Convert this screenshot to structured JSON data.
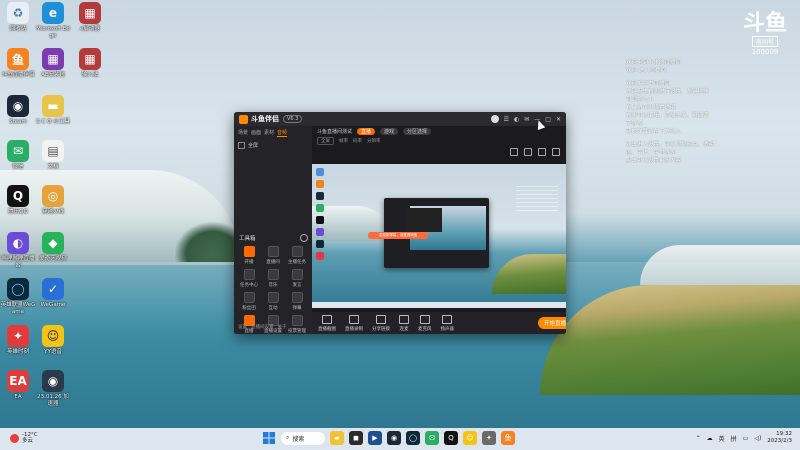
{
  "desktop": {
    "icons": [
      {
        "label": "回收站",
        "color": "#e8eef5",
        "glyph": "♻",
        "fg": "#4a78b0"
      },
      {
        "label": "Microsoft Edge",
        "color": "#1f8fd8",
        "glyph": "e",
        "fg": "#fff"
      },
      {
        "label": "e启动器",
        "color": "#b33b3b",
        "glyph": "▦",
        "fg": "#fff"
      },
      {
        "label": "斗鱼直播伴侣",
        "color": "#f5821f",
        "glyph": "鱼",
        "fg": "#fff"
      },
      {
        "label": "AE安装包",
        "color": "#7a3cae",
        "glyph": "▦",
        "fg": "#fff"
      },
      {
        "label": "输入法",
        "color": "#b33b3b",
        "glyph": "▦",
        "fg": "#fff"
      },
      {
        "label": "Steam",
        "color": "#1b2838",
        "glyph": "◉",
        "fg": "#fff"
      },
      {
        "label": "S C O 小工具",
        "color": "#e8c44a",
        "glyph": "▬",
        "fg": "#fff"
      },
      {
        "label": "微信",
        "color": "#2aae67",
        "glyph": "✉",
        "fg": "#fff"
      },
      {
        "label": "文档",
        "color": "#f2f2f2",
        "glyph": "▤",
        "fg": "#555"
      },
      {
        "label": "腾讯QQ",
        "color": "#111",
        "glyph": "Q",
        "fg": "#fff"
      },
      {
        "label": "穿越火线",
        "color": "#e6a23c",
        "glyph": "◎",
        "fg": "#fff"
      },
      {
        "label": "哔哩哔哩直播姬",
        "color": "#6a4cd6",
        "glyph": "◐",
        "fg": "#fff"
      },
      {
        "label": "爱奇艺视频",
        "color": "#27b35a",
        "glyph": "◆",
        "fg": "#fff"
      },
      {
        "label": "英雄联盟WeGame",
        "color": "#0d2a3a",
        "glyph": "◯",
        "fg": "#58c7ff"
      },
      {
        "label": "WeGame",
        "color": "#2a6fd8",
        "glyph": "✓",
        "fg": "#fff"
      },
      {
        "label": "英雄时刻",
        "color": "#e23b3b",
        "glyph": "✦",
        "fg": "#fff"
      },
      {
        "label": "YY语音",
        "color": "#f5c218",
        "glyph": "☺",
        "fg": "#222"
      },
      {
        "label": "EA",
        "color": "#e23b3b",
        "glyph": "EA",
        "fg": "#fff"
      },
      {
        "label": "23.01.26 加速器",
        "color": "#2b3a4a",
        "glyph": "◉",
        "fg": "#fff"
      }
    ]
  },
  "stream_logo": {
    "mark": "斗鱼",
    "badge": "房间号",
    "room": "100009"
  },
  "chat_overlay": {
    "lines": [
      "欢迎来到小米的直播间",
      "欢迎 进入直播间",
      "",
      "欢迎关注本直播间",
      "左键点击右侧进行设置，左键拉伸",
      "可调整大小",
      "右上角可以设置透明",
      "右侧可以编辑，添加头像，粗细调",
      "节等等",
      "新的弹幕请在下方输入",
      "",
      "双击进入设置，可以调整颜色、透明",
      "度、字体、字号等等",
      "点击可以设置更多内容"
    ]
  },
  "app": {
    "title": "斗鱼伴侣",
    "version": "V6.3",
    "left_tabs": [
      "场景",
      "画面",
      "素材",
      "音频"
    ],
    "scene_label": "全屏",
    "tools_title": "工具箱",
    "tools": [
      {
        "label": "开播",
        "hot": true
      },
      {
        "label": "直播间",
        "hot": false
      },
      {
        "label": "主播任务",
        "hot": false
      },
      {
        "label": "任务中心",
        "hot": false
      },
      {
        "label": "音乐",
        "hot": false
      },
      {
        "label": "发言",
        "hot": false
      },
      {
        "label": "粉丝团",
        "hot": false
      },
      {
        "label": "互动",
        "hot": false
      },
      {
        "label": "弹幕",
        "hot": false
      },
      {
        "label": "直播",
        "hot": true
      },
      {
        "label": "直播设置",
        "hot": false
      },
      {
        "label": "投票管理",
        "hot": false
      }
    ],
    "lp_bottom": [
      "设置",
      "直播间设置",
      "关于"
    ],
    "top_bar": {
      "room_title": "斗鱼直播间测试",
      "live_tag": "直播",
      "tag2": "游戏",
      "tag3": "分区选择"
    },
    "sub_bar": [
      "全屏",
      "帧率",
      "码率",
      "分辨率"
    ],
    "popup": "发现新弹幕，设置透明度",
    "bottom_buttons": [
      "直播截图",
      "直播录制",
      "分享链接",
      "连麦",
      "麦克风",
      "扬声器"
    ],
    "start_live": "开始直播"
  },
  "taskbar": {
    "weather_temp": "-12°C",
    "weather_desc": "多云",
    "search_label": "搜索",
    "pinned": [
      {
        "name": "file-explorer",
        "color": "#f2c230",
        "glyph": "▰"
      },
      {
        "name": "store",
        "color": "#2b2b2b",
        "glyph": "◼"
      },
      {
        "name": "media",
        "color": "#1f4f8f",
        "glyph": "▶"
      },
      {
        "name": "steam",
        "color": "#1b2838",
        "glyph": "◉"
      },
      {
        "name": "game-client",
        "color": "#0d2a3a",
        "glyph": "◯"
      },
      {
        "name": "wechat",
        "color": "#2aae67",
        "glyph": "✉"
      },
      {
        "name": "qq",
        "color": "#111",
        "glyph": "Q"
      },
      {
        "name": "yy",
        "color": "#f5c218",
        "glyph": "☺"
      },
      {
        "name": "tools",
        "color": "#6a6a6a",
        "glyph": "✦"
      },
      {
        "name": "douyu",
        "color": "#f5821f",
        "glyph": "鱼"
      }
    ],
    "tray_lang1": "英",
    "tray_lang2": "拼",
    "time": "19:32",
    "date": "2023/2/3"
  }
}
